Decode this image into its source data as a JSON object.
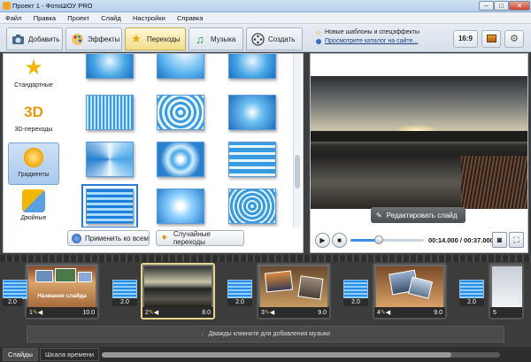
{
  "window": {
    "title": "Проект 1 - ФотоШОУ PRO",
    "min": "–",
    "max": "□",
    "close": "✕"
  },
  "menu": [
    "Файл",
    "Правка",
    "Проект",
    "Слайд",
    "Настройки",
    "Справка"
  ],
  "tabs": [
    {
      "label": "Добавить",
      "icon": "camera-icon"
    },
    {
      "label": "Эффекты",
      "icon": "palette-icon"
    },
    {
      "label": "Переходы",
      "icon": "star-icon"
    },
    {
      "label": "Музыка",
      "icon": "music-note-icon"
    },
    {
      "label": "Создать",
      "icon": "film-reel-icon"
    }
  ],
  "catalog": {
    "new_templates": "Новые шаблоны и спецэффекты",
    "browse_link": "Просмотрите каталог на сайте..."
  },
  "toolbar": {
    "aspect": "16:9"
  },
  "categories": [
    {
      "label": "Стандартные"
    },
    {
      "label": "3D-переходы"
    },
    {
      "label": "Градиенты",
      "selected": true
    },
    {
      "label": "Двойные"
    }
  ],
  "actions": {
    "apply_all": "Применить ко всем",
    "random": "Случайные переходы"
  },
  "preview": {
    "edit_button": "Редактировать слайд",
    "time_current": "00:14.000",
    "time_total": "00:37.000",
    "time_sep": " / ",
    "progress": 0.38
  },
  "slides": [
    {
      "num": "1",
      "duration": "10.0",
      "caption": "Название слайда"
    },
    {
      "num": "2",
      "duration": "8.0",
      "selected": true
    },
    {
      "num": "3",
      "duration": "9.0"
    },
    {
      "num": "4",
      "duration": "9.0"
    },
    {
      "num": "5",
      "duration": ""
    }
  ],
  "transitions": [
    "2.0",
    "2.0",
    "2.0",
    "2.0",
    "2.0"
  ],
  "timeline": {
    "music_hint": "Дважды кликните для добавления музыки"
  },
  "bottom_tabs": [
    "Слайды",
    "Шкала времени"
  ],
  "colors": {
    "accent": "#3a8fe0",
    "selected_tab": "#f4df8a"
  }
}
